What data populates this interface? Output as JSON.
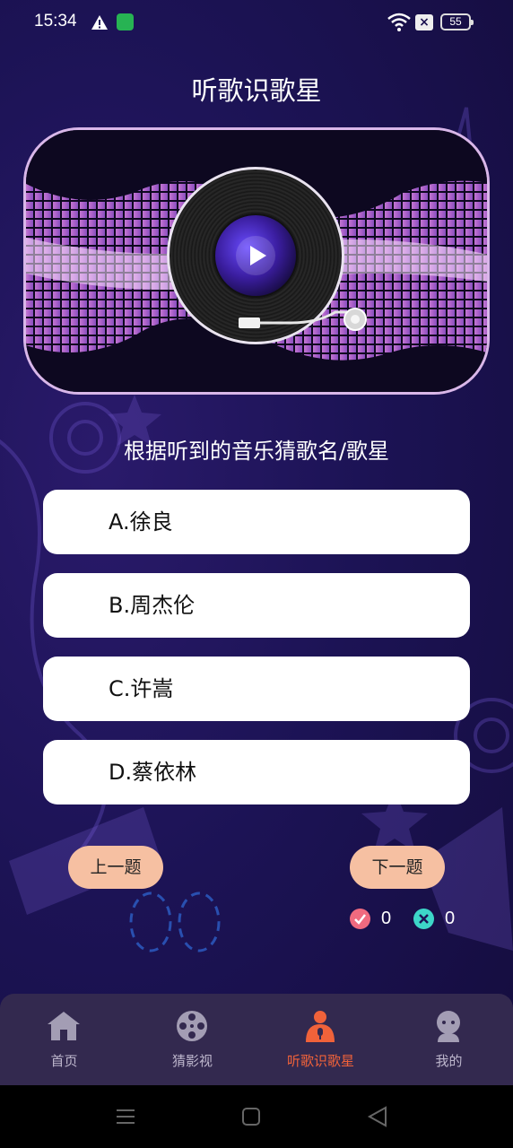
{
  "status_bar": {
    "time": "15:34",
    "battery": "55"
  },
  "page_title": "听歌识歌星",
  "question": "根据听到的音乐猜歌名/歌星",
  "options": [
    {
      "label": "A.徐良"
    },
    {
      "label": "B.周杰伦"
    },
    {
      "label": "C.许嵩"
    },
    {
      "label": "D.蔡依林"
    }
  ],
  "buttons": {
    "prev": "上一题",
    "next": "下一题"
  },
  "score": {
    "correct": "0",
    "wrong": "0"
  },
  "tabbar": [
    {
      "label": "首页",
      "icon": "home-icon"
    },
    {
      "label": "猜影视",
      "icon": "film-reel-icon"
    },
    {
      "label": "听歌识歌星",
      "icon": "singer-icon",
      "active": true
    },
    {
      "label": "我的",
      "icon": "profile-icon"
    }
  ],
  "colors": {
    "accent": "#f0623a",
    "button": "#f6c0a2",
    "correct": "#f06a7f",
    "wrong": "#3dd6c8"
  }
}
